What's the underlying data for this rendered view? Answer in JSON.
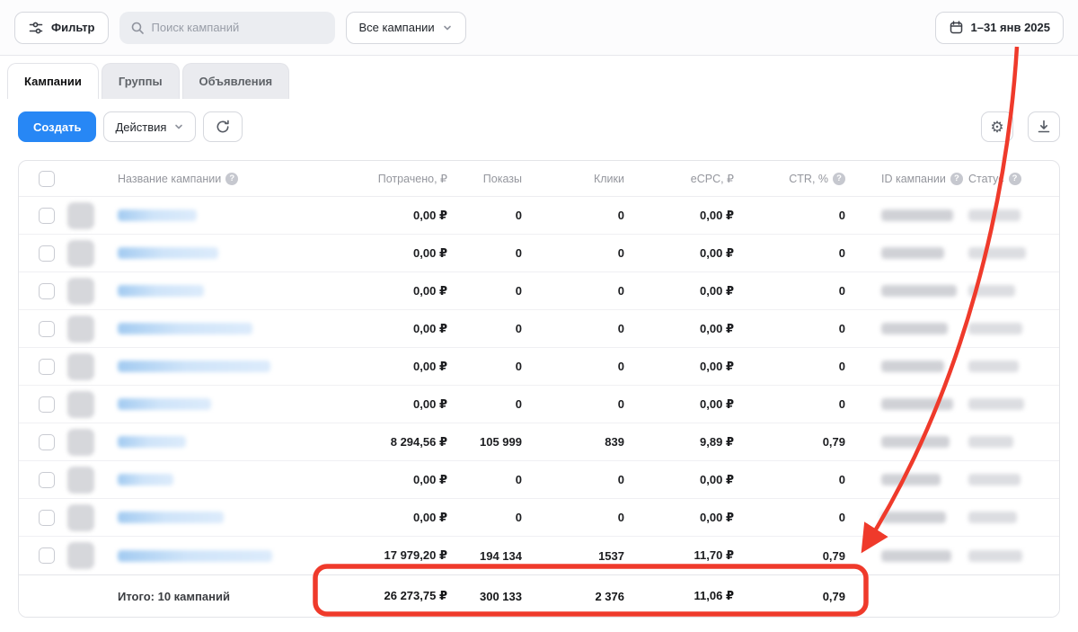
{
  "topbar": {
    "filter_label": "Фильтр",
    "search_placeholder": "Поиск кампаний",
    "scope_value": "Все кампании",
    "date_range": "1–31 янв 2025"
  },
  "tabs": [
    {
      "key": "campaigns",
      "label": "Кампании",
      "active": true
    },
    {
      "key": "groups",
      "label": "Группы",
      "active": false
    },
    {
      "key": "ads",
      "label": "Объявления",
      "active": false
    }
  ],
  "toolbar": {
    "create_label": "Создать",
    "actions_label": "Действия"
  },
  "icons": {
    "gear": "⚙"
  },
  "table": {
    "columns": [
      {
        "key": "name",
        "label": "Название кампании",
        "help": true
      },
      {
        "key": "spent",
        "label": "Потрачено, ₽",
        "help": false
      },
      {
        "key": "shows",
        "label": "Показы",
        "help": false
      },
      {
        "key": "clicks",
        "label": "Клики",
        "help": false
      },
      {
        "key": "ecpc",
        "label": "eCPC, ₽",
        "help": false
      },
      {
        "key": "ctr",
        "label": "CTR, %",
        "help": true
      },
      {
        "key": "id",
        "label": "ID кампании",
        "help": true
      },
      {
        "key": "status",
        "label": "Статус",
        "help": true
      }
    ],
    "rows": [
      {
        "spent": "0,00 ₽",
        "shows": "0",
        "clicks": "0",
        "ecpc": "0,00 ₽",
        "ctr": "0",
        "name_w": 88,
        "id_w": 80,
        "status_w": 58
      },
      {
        "spent": "0,00 ₽",
        "shows": "0",
        "clicks": "0",
        "ecpc": "0,00 ₽",
        "ctr": "0",
        "name_w": 112,
        "id_w": 70,
        "status_w": 64
      },
      {
        "spent": "0,00 ₽",
        "shows": "0",
        "clicks": "0",
        "ecpc": "0,00 ₽",
        "ctr": "0",
        "name_w": 96,
        "id_w": 84,
        "status_w": 52
      },
      {
        "spent": "0,00 ₽",
        "shows": "0",
        "clicks": "0",
        "ecpc": "0,00 ₽",
        "ctr": "0",
        "name_w": 150,
        "id_w": 74,
        "status_w": 60
      },
      {
        "spent": "0,00 ₽",
        "shows": "0",
        "clicks": "0",
        "ecpc": "0,00 ₽",
        "ctr": "0",
        "name_w": 170,
        "id_w": 70,
        "status_w": 56
      },
      {
        "spent": "0,00 ₽",
        "shows": "0",
        "clicks": "0",
        "ecpc": "0,00 ₽",
        "ctr": "0",
        "name_w": 104,
        "id_w": 80,
        "status_w": 62
      },
      {
        "spent": "8 294,56 ₽",
        "shows": "105 999",
        "clicks": "839",
        "ecpc": "9,89 ₽",
        "ctr": "0,79",
        "name_w": 76,
        "id_w": 76,
        "status_w": 50
      },
      {
        "spent": "0,00 ₽",
        "shows": "0",
        "clicks": "0",
        "ecpc": "0,00 ₽",
        "ctr": "0",
        "name_w": 62,
        "id_w": 66,
        "status_w": 58
      },
      {
        "spent": "0,00 ₽",
        "shows": "0",
        "clicks": "0",
        "ecpc": "0,00 ₽",
        "ctr": "0",
        "name_w": 118,
        "id_w": 72,
        "status_w": 54
      },
      {
        "spent": "17 979,20 ₽",
        "shows": "194 134",
        "clicks": "1537",
        "ecpc": "11,70 ₽",
        "ctr": "0,79",
        "name_w": 172,
        "id_w": 78,
        "status_w": 60
      }
    ],
    "totals": {
      "label": "Итого: 10 кампаний",
      "spent": "26 273,75 ₽",
      "shows": "300 133",
      "clicks": "2 376",
      "ecpc": "11,06 ₽",
      "ctr": "0,79"
    }
  },
  "colors": {
    "accent": "#2787f5",
    "annotation": "#ef3a2b"
  }
}
